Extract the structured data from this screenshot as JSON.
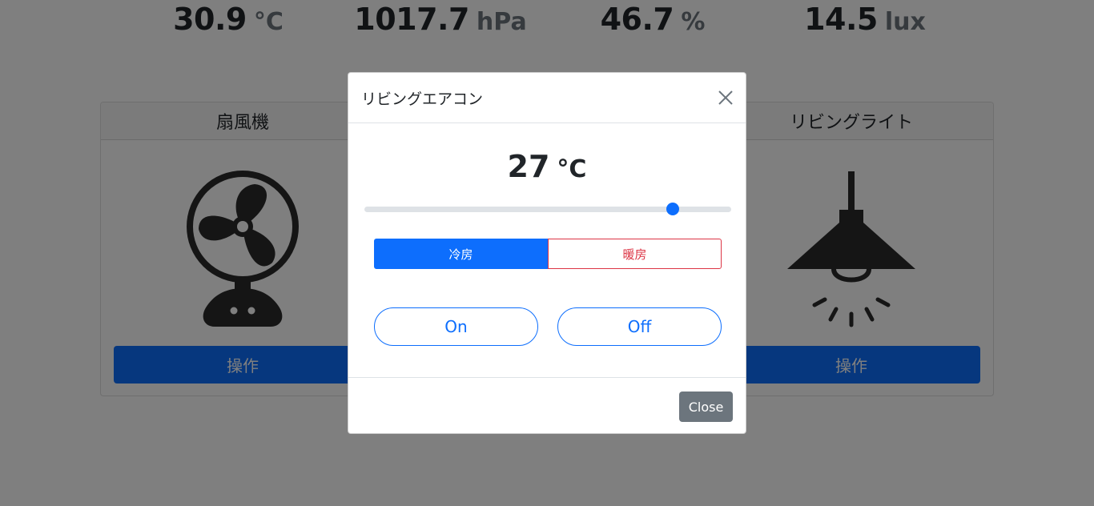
{
  "sensors": [
    {
      "value": "30.9",
      "unit": "°C"
    },
    {
      "value": "1017.7",
      "unit": "hPa"
    },
    {
      "value": "46.7",
      "unit": "%"
    },
    {
      "value": "14.5",
      "unit": "lux"
    }
  ],
  "devices": [
    {
      "name": "扇風機",
      "icon": "fan-icon",
      "button_label": "操作"
    },
    {
      "name": "リビングライト",
      "icon": "ceiling-lamp-icon",
      "button_label": "操作"
    }
  ],
  "modal": {
    "title": "リビングエアコン",
    "temperature": {
      "value": "27",
      "unit": "°C"
    },
    "slider": {
      "fraction": 0.84
    },
    "modes": {
      "cool_label": "冷房",
      "heat_label": "暖房",
      "selected": "cool"
    },
    "on_label": "On",
    "off_label": "Off",
    "close_label": "Close"
  },
  "colors": {
    "primary": "#0d6efd",
    "danger": "#dc3545",
    "secondary": "#6c757d"
  }
}
